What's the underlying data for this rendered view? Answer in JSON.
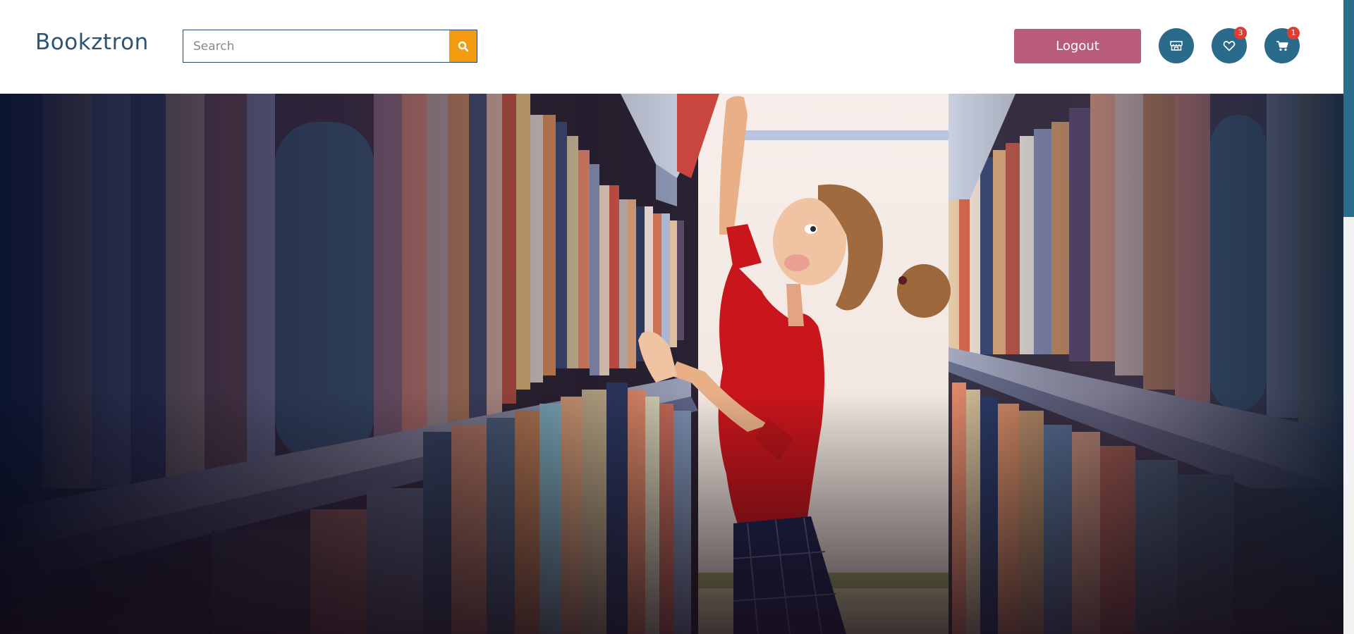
{
  "brand": {
    "name": "Bookztron"
  },
  "search": {
    "placeholder": "Search",
    "value": "",
    "button_icon": "search-icon"
  },
  "header": {
    "logout_label": "Logout",
    "shop_icon": "store-icon",
    "wishlist_icon": "heart-icon",
    "wishlist_count": "3",
    "cart_icon": "cart-icon",
    "cart_count": "1"
  },
  "hero": {
    "image": "illustration of a woman reaching for a book on a library shelf"
  },
  "colors": {
    "brand": "#2c5475",
    "accent_orange": "#f39c12",
    "logout": "#b85c79",
    "icon_button": "#2a6a8a",
    "badge": "#e03c31"
  }
}
